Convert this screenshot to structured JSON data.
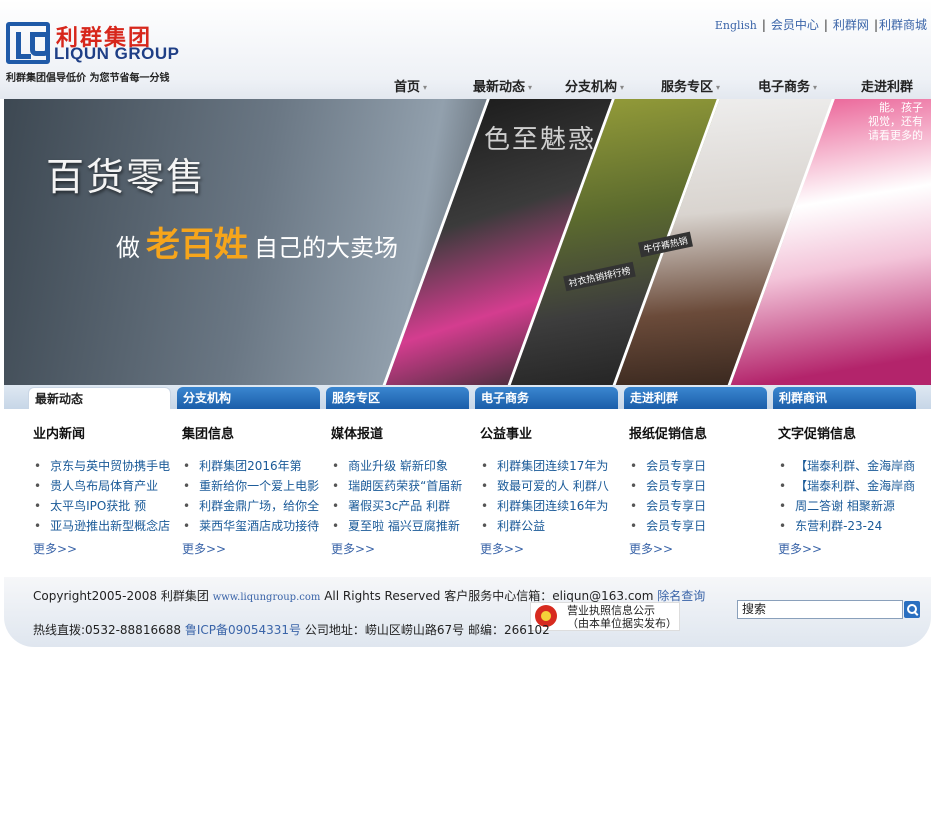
{
  "header": {
    "logo_cn": "利群集团",
    "logo_en": "LIQUN GROUP",
    "slogan": "利群集团倡导低价 为您节省每一分钱",
    "toplinks": [
      "English",
      "会员中心",
      "利群网",
      "利群商城"
    ],
    "nav": [
      {
        "label": "首页",
        "caret": true
      },
      {
        "label": "最新动态",
        "caret": true
      },
      {
        "label": "分支机构",
        "caret": true
      },
      {
        "label": "服务专区",
        "caret": true
      },
      {
        "label": "电子商务",
        "caret": true
      },
      {
        "label": "走进利群",
        "caret": false
      }
    ]
  },
  "banner": {
    "title": "百货零售",
    "sub_pre": "做",
    "sub_highlight": "老百姓",
    "sub_post": "自己的大卖场",
    "tag": "色至魅惑",
    "corner_text": [
      "能。孩子",
      "视觉，还有",
      "请看更多的"
    ],
    "strip_labels": [
      "衬衣热销排行榜",
      "牛仔裤热销"
    ]
  },
  "tabs": [
    "最新动态",
    "分支机构",
    "服务专区",
    "电子商务",
    "走进利群",
    "利群商讯"
  ],
  "columns": [
    {
      "title": "业内新闻",
      "items": [
        "京东与英中贸协携手电",
        "贵人鸟布局体育产业",
        "太平鸟IPO获批 预",
        "亚马逊推出新型概念店"
      ],
      "more": "更多>>"
    },
    {
      "title": "集团信息",
      "items": [
        "利群集团2016年第",
        "重新给你一个爱上电影",
        "利群金鼎广场，给你全",
        "莱西华玺酒店成功接待"
      ],
      "more": "更多>>"
    },
    {
      "title": "媒体报道",
      "items": [
        "商业升级 崭新印象",
        "瑞朗医药荣获“首届新",
        "署假买3c产品 利群",
        "夏至啦 福兴豆腐推新"
      ],
      "more": "更多>>"
    },
    {
      "title": "公益事业",
      "items": [
        "利群集团连续17年为",
        "致最可爱的人 利群八",
        "利群集团连续16年为",
        "利群公益"
      ],
      "more": "更多>>"
    },
    {
      "title": "报纸促销信息",
      "items": [
        "会员专享日",
        "会员专享日",
        "会员专享日",
        "会员专享日"
      ],
      "more": "更多>>"
    },
    {
      "title": "文字促销信息",
      "items": [
        "【瑞泰利群、金海岸商",
        "【瑞泰利群、金海岸商",
        "周二答谢 相聚新源",
        "东营利群-23-24"
      ],
      "more": "更多>>"
    }
  ],
  "footer": {
    "copyright_pre": "Copyright2005-2008 利群集团",
    "site": "www.liqungroup.com",
    "copyright_post": "All Rights Reserved 客户服务中心信箱：eliqun@163.com",
    "domain_check": "除名查询",
    "hotline": "热线直拨:0532-88816688",
    "icp": "鲁ICP备09054331号",
    "address": "公司地址：崂山区崂山路67号 邮编：266102",
    "badge_line1": "营业执照信息公示",
    "badge_line2": "（由本单位据实发布）",
    "search_placeholder": "搜索"
  }
}
